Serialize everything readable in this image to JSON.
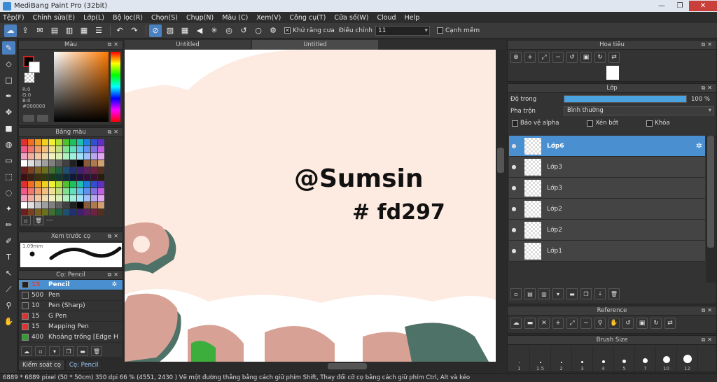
{
  "window": {
    "title": "MediBang Paint Pro (32bit)",
    "minimize": "—",
    "restore": "❐",
    "close": "✕"
  },
  "menu": [
    "Tệp(F)",
    "Chỉnh sửa(E)",
    "Lớp(L)",
    "Bộ lọc(R)",
    "Chọn(S)",
    "Chụp(N)",
    "Màu (C)",
    "Xem(V)",
    "Công cụ(T)",
    "Cửa số(W)",
    "Cloud",
    "Help"
  ],
  "toolbar": {
    "antialias_label": "Khử răng cưa",
    "antialias_checked": "✕",
    "adjust_label": "Điều chỉnh",
    "adjust_value": "11",
    "smooth_label": "Cạnh mềm"
  },
  "color_panel": {
    "title": "Màu",
    "r": "R:0",
    "g": "G:0",
    "b": "B:0",
    "hex": "#000000",
    "fg": "#000000",
    "bg": "#ffffff"
  },
  "palette_panel": {
    "title": "Bảng màu",
    "dash": "---"
  },
  "preview_panel": {
    "title": "Xem trước cọ",
    "size": "1.09mm"
  },
  "brush_panel": {
    "title": "Cọ: Pencil",
    "brushes": [
      {
        "size": "15",
        "name": "Pencil",
        "color": "#cc2222"
      },
      {
        "size": "500",
        "name": "Pen",
        "color": "#333333"
      },
      {
        "size": "10",
        "name": "Pen (Sharp)",
        "color": "#333333"
      },
      {
        "size": "15",
        "name": "G Pen",
        "color": "#e03030"
      },
      {
        "size": "15",
        "name": "Mapping Pen",
        "color": "#e03030"
      },
      {
        "size": "400",
        "name": "Khoảng trống [Edge H",
        "color": "#30a030"
      }
    ]
  },
  "bottom_tabs": [
    "Kiểm soát cọ",
    "Cọ: Pencil"
  ],
  "doc_tabs": [
    "Untitled",
    "Untitled"
  ],
  "canvas": {
    "line1": "@Sumsin",
    "line2": "# fd297"
  },
  "nav_panel": {
    "title": "Hoa tiêu"
  },
  "layer_panel": {
    "title": "Lớp",
    "opacity_label": "Độ trong",
    "opacity_value": "100 %",
    "opacity_fraction": 1.0,
    "blend_label": "Pha trộn",
    "blend_value": "Bình thường",
    "lock_alpha": "Bảo vệ alpha",
    "clipping": "Xén bớt",
    "lock": "Khóa",
    "layers": [
      "Lớp6",
      "Lớp3",
      "Lớp3",
      "Lớp2",
      "Lớp2",
      "Lớp1"
    ]
  },
  "ref_panel": {
    "title": "Reference"
  },
  "brushsize_panel": {
    "title": "Brush Size",
    "sizes": [
      "1",
      "1.5",
      "2",
      "3",
      "4",
      "5",
      "7",
      "10",
      "12"
    ]
  },
  "status": "6889 * 6889 pixel   (50 * 50cm)   350 dpi   66 %   (4551, 2430 )   Vẽ một đường thẳng bằng cách giữ phím Shift, Thay đổi cỡ cọ bằng cách giữ phím Ctrl, Alt và kéo"
}
